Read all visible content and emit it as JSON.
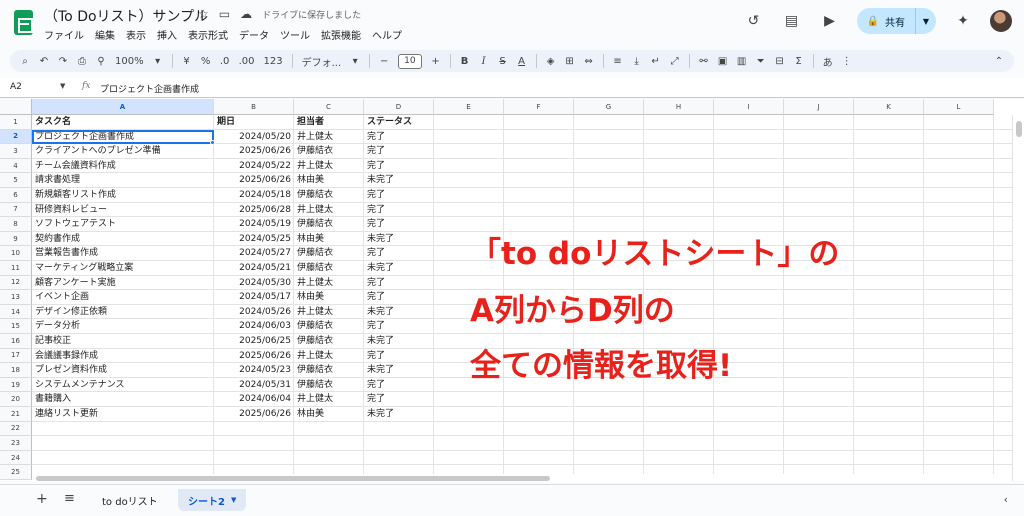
{
  "title": "（To Doリスト）サンプル",
  "title_icons": [
    "star-icon",
    "move-to-folder-icon",
    "cloud-saved-icon"
  ],
  "saved_status": "ドライブに保存しました",
  "menu": [
    "ファイル",
    "編集",
    "表示",
    "挿入",
    "表示形式",
    "データ",
    "ツール",
    "拡張機能",
    "ヘルプ"
  ],
  "share_label": "共有",
  "toolbar": {
    "zoom": "100%",
    "currency": "¥",
    "percent": "%",
    "dec_decrease": ".0",
    "dec_increase": ".00",
    "format_123": "123",
    "font": "デフォ...",
    "font_size": "10",
    "input_tool": "あ"
  },
  "formula_bar": {
    "name_box": "A2",
    "fx": "fx",
    "formula": "プロジェクト企画書作成"
  },
  "columns": [
    "A",
    "B",
    "C",
    "D",
    "E",
    "F",
    "G",
    "H",
    "I",
    "J",
    "K",
    "L"
  ],
  "row_numbers": [
    "1",
    "2",
    "3",
    "4",
    "5",
    "6",
    "7",
    "8",
    "9",
    "10",
    "11",
    "12",
    "13",
    "14",
    "15",
    "16",
    "17",
    "18",
    "19",
    "20",
    "21",
    "22",
    "23",
    "24",
    "25"
  ],
  "header_row": [
    "タスク名",
    "期日",
    "担当者",
    "ステータス"
  ],
  "rows": [
    [
      "プロジェクト企画書作成",
      "2024/05/20",
      "井上健太",
      "完了"
    ],
    [
      "クライアントへのプレゼン準備",
      "2025/06/26",
      "伊藤結衣",
      "完了"
    ],
    [
      "チーム会議資料作成",
      "2024/05/22",
      "井上健太",
      "完了"
    ],
    [
      "請求書処理",
      "2025/06/26",
      "林由美",
      "未完了"
    ],
    [
      "新規顧客リスト作成",
      "2024/05/18",
      "伊藤結衣",
      "完了"
    ],
    [
      "研修資料レビュー",
      "2025/06/28",
      "井上健太",
      "完了"
    ],
    [
      "ソフトウェアテスト",
      "2024/05/19",
      "伊藤結衣",
      "完了"
    ],
    [
      "契約書作成",
      "2024/05/25",
      "林由美",
      "未完了"
    ],
    [
      "営業報告書作成",
      "2024/05/27",
      "伊藤結衣",
      "完了"
    ],
    [
      "マーケティング戦略立案",
      "2024/05/21",
      "伊藤結衣",
      "未完了"
    ],
    [
      "顧客アンケート実施",
      "2024/05/30",
      "井上健太",
      "完了"
    ],
    [
      "イベント企画",
      "2024/05/17",
      "林由美",
      "完了"
    ],
    [
      "デザイン修正依頼",
      "2024/05/26",
      "井上健太",
      "未完了"
    ],
    [
      "データ分析",
      "2024/06/03",
      "伊藤結衣",
      "完了"
    ],
    [
      "記事校正",
      "2025/06/25",
      "伊藤結衣",
      "未完了"
    ],
    [
      "会議議事録作成",
      "2025/06/26",
      "井上健太",
      "完了"
    ],
    [
      "プレゼン資料作成",
      "2024/05/23",
      "伊藤結衣",
      "未完了"
    ],
    [
      "システムメンテナンス",
      "2024/05/31",
      "伊藤結衣",
      "完了"
    ],
    [
      "書籍購入",
      "2024/06/04",
      "井上健太",
      "完了"
    ],
    [
      "連絡リスト更新",
      "2025/06/26",
      "林由美",
      "未完了"
    ]
  ],
  "annotation": {
    "line1": "「to doリストシート」の",
    "line2": "A列からD列の",
    "line3": "全ての情報を取得!",
    "color": "#e8221b"
  },
  "sheets": [
    {
      "label": "to doリスト",
      "active": false
    },
    {
      "label": "シート2",
      "active": true
    }
  ],
  "accent_color": "#1a73e8"
}
